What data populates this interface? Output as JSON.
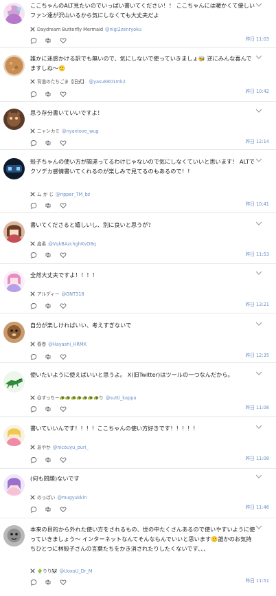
{
  "ui": {
    "x_icon": "x-logo-icon",
    "reply_icon": "reply-icon",
    "retweet_icon": "retweet-icon",
    "like_icon": "heart-icon",
    "menu_icon": "chevron-down-icon",
    "link_color": "#6a8fc4"
  },
  "replies": [
    {
      "text": "ここちゃんのALT見たいのでいっぱい書いてください！！ ここちゃんには暖かくて優しいファン達が沢山いるから気にしなくても大丈夫だよ",
      "name": "Daydream Butterfly Mermaid",
      "handle": "@nigi2zenryoku",
      "time": "昨日 11:03"
    },
    {
      "text": "誰かに迷惑かける訳でも無いので、気にしないで使っていきましょ🐝 逆にみんな喜んでますしね〜🙂",
      "name": "背道のたちごま【旧式】",
      "handle": "@yasu8801mk2",
      "time": "昨日 10:42"
    },
    {
      "text": "思う存分書いていいですよ！",
      "name": "ニャンカミ",
      "handle": "@nyanlove_wug",
      "time": "昨日 12:14"
    },
    {
      "text": "殻子ちゃんの使い方が間違ってるわけじゃないので気にしなくていいと思います！ ALTでクソデカ感情書いてくれるのが楽しみで見てるのもあるので！！",
      "name": "ム か じ",
      "handle": "@ripper_TM_bz",
      "time": "昨日 10:41"
    },
    {
      "text": "書いてくださると嬉しいし、別に良いと思うが？",
      "name": "扁柔",
      "handle": "@VqkBAzchghKvO8q",
      "time": "昨日 11:53"
    },
    {
      "text": "全然大丈夫ですよ！！！！",
      "name": "アルディー",
      "handle": "@GNT318",
      "time": "昨日 13:21"
    },
    {
      "text": "自分が楽しければいい、考えすぎないで",
      "name": "春巻",
      "handle": "@Hayashi_HRMK",
      "time": "昨日 12:35"
    },
    {
      "text": "使いたいように使えばいいと思うよ。 X(旧Twitter)はツールの一つなんだから。",
      "name": "@すっちー🐢🐢🐢🐢🐢🐢🐢り",
      "handle": "@sutti_kappa",
      "time": "昨日 11:08"
    },
    {
      "text": "書いていいんです！！！！ここちゃんの使い方好きです！！！！！",
      "name": "あやか",
      "handle": "@nicouyu_puri_",
      "time": "昨日 11:08"
    },
    {
      "text": "(何も問題)ないです",
      "name": "のっぱい",
      "handle": "@mugyukkin",
      "time": "昨日 11:46"
    },
    {
      "text": "本来の目的から外れた使い方をされるもの、世の中たくさんあるので使いやすいように使っていきましょう〜 インターネットなんてそんなもんでいいと思います🙂誰かのお気持ちひとつに林殻子さんの言葉たちをかき消されたりしたくないです、、、",
      "name": "🌵りり🐼",
      "handle": "@UoxoU_Dr_M",
      "time": "昨日 11:51"
    }
  ]
}
